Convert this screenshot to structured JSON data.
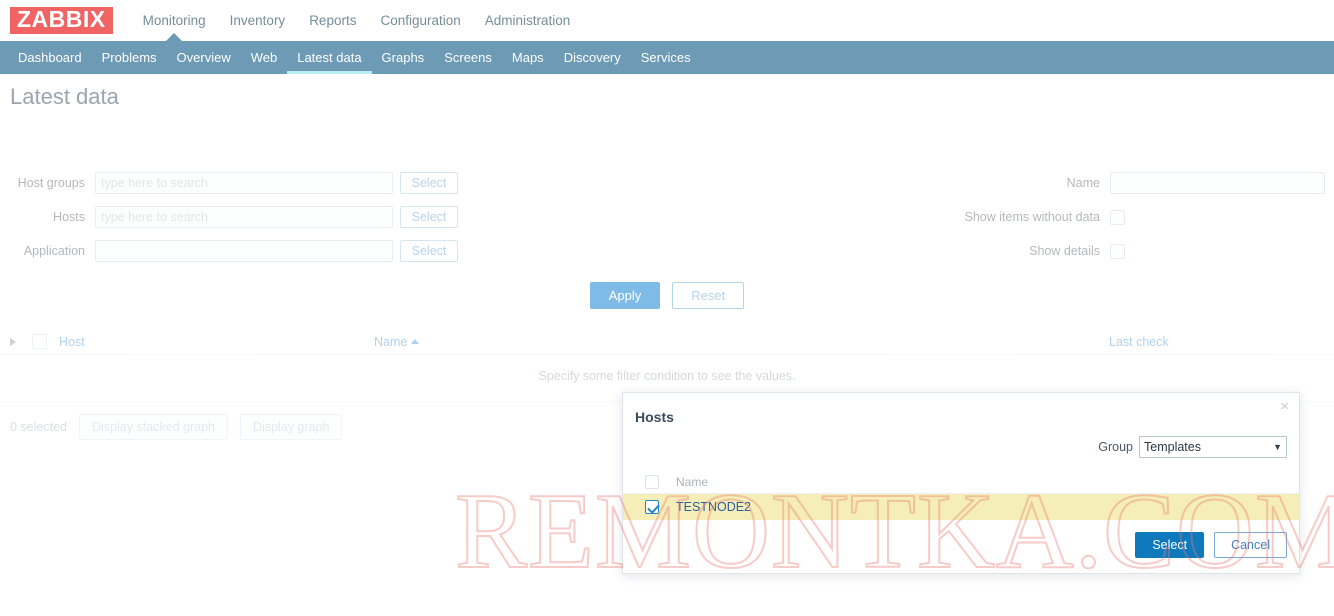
{
  "app": {
    "logo": "ZABBIX",
    "watermark": "REMONTKA.COM"
  },
  "topnav": {
    "items": [
      {
        "label": "Monitoring",
        "active": true
      },
      {
        "label": "Inventory",
        "active": false
      },
      {
        "label": "Reports",
        "active": false
      },
      {
        "label": "Configuration",
        "active": false
      },
      {
        "label": "Administration",
        "active": false
      }
    ]
  },
  "subnav": {
    "items": [
      {
        "label": "Dashboard",
        "active": false
      },
      {
        "label": "Problems",
        "active": false
      },
      {
        "label": "Overview",
        "active": false
      },
      {
        "label": "Web",
        "active": false
      },
      {
        "label": "Latest data",
        "active": true
      },
      {
        "label": "Graphs",
        "active": false
      },
      {
        "label": "Screens",
        "active": false
      },
      {
        "label": "Maps",
        "active": false
      },
      {
        "label": "Discovery",
        "active": false
      },
      {
        "label": "Services",
        "active": false
      }
    ]
  },
  "page": {
    "title": "Latest data"
  },
  "filter": {
    "host_groups": {
      "label": "Host groups",
      "value": "",
      "placeholder": "type here to search",
      "select_label": "Select"
    },
    "hosts": {
      "label": "Hosts",
      "value": "",
      "placeholder": "type here to search",
      "select_label": "Select"
    },
    "application": {
      "label": "Application",
      "value": "",
      "placeholder": "",
      "select_label": "Select"
    },
    "name": {
      "label": "Name",
      "value": "",
      "placeholder": ""
    },
    "show_items_without_data": {
      "label": "Show items without data",
      "checked": false
    },
    "show_details": {
      "label": "Show details",
      "checked": false
    },
    "apply_label": "Apply",
    "reset_label": "Reset"
  },
  "results": {
    "columns": {
      "host": "Host",
      "name": "Name",
      "last_check": "Last check"
    },
    "sort_column": "Name",
    "sort_direction": "asc",
    "empty_message": "Specify some filter condition to see the values.",
    "selected_count": "0 selected",
    "display_stacked_graph_label": "Display stacked graph",
    "display_graph_label": "Display graph"
  },
  "modal": {
    "title": "Hosts",
    "close_label": "×",
    "group": {
      "label": "Group",
      "selected": "Templates",
      "options": [
        "Templates"
      ]
    },
    "table": {
      "column_name": "Name",
      "rows": [
        {
          "name": "TESTNODE2",
          "checked": true,
          "highlighted": true
        }
      ]
    },
    "select_label": "Select",
    "cancel_label": "Cancel"
  },
  "colors": {
    "logo_bg": "#f06464",
    "subnav_bg": "#6d9ab5",
    "subnav_active_underline": "#bcecf7",
    "apply_button": "#68b0e3",
    "modal_primary_button": "#0f79bd",
    "row_highlight": "#f5eeb8",
    "link_text": "#63a6dd",
    "watermark": "#e8786e"
  }
}
